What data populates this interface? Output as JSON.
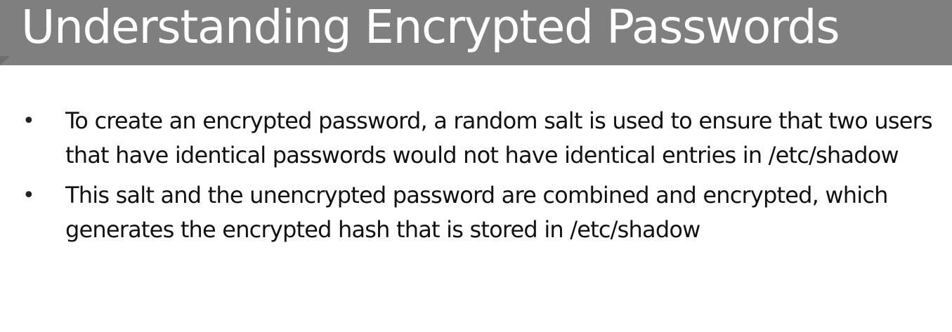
{
  "slide": {
    "title": "Understanding Encrypted Passwords",
    "bullets": [
      {
        "marker": "•",
        "text": "To create an encrypted password, a random salt is used to ensure that two users that have identical passwords would not have identical entries in /etc/shadow"
      },
      {
        "marker": "•",
        "text": "This salt and the unencrypted password are combined and encrypted, which generates the encrypted hash that is stored in /etc/shadow"
      }
    ]
  },
  "colors": {
    "title_bar": "#7f7f7f",
    "title_text": "#ffffff",
    "body_text": "#111111",
    "background": "#ffffff"
  }
}
